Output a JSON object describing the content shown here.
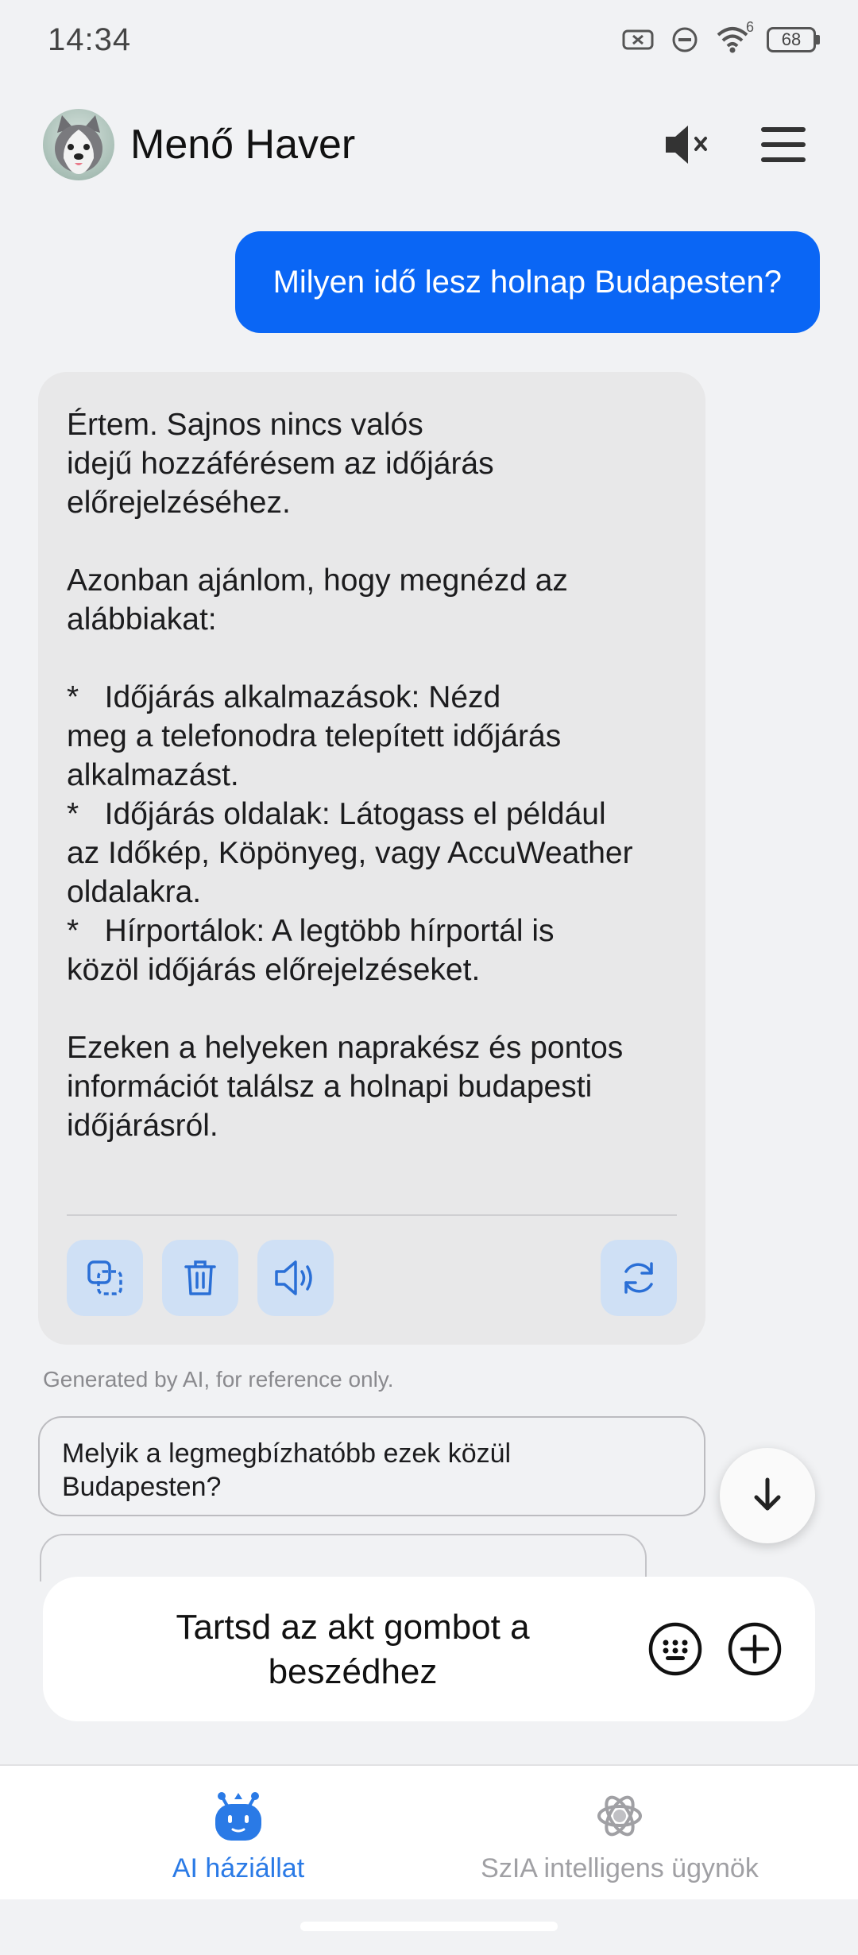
{
  "status_bar": {
    "time": "14:34",
    "battery": "68",
    "wifi_badge": "6",
    "icons": [
      "sim-off-icon",
      "do-not-disturb-icon",
      "wifi-icon",
      "battery-icon"
    ]
  },
  "header": {
    "title": "Menő Haver",
    "avatar": "husky-avatar",
    "icons": [
      "speaker-muted-icon",
      "menu-icon"
    ]
  },
  "conversation": {
    "user_message": "Milyen idő lesz holnap Budapesten?",
    "ai_message": {
      "paragraphs": [
        "Értem. Sajnos nincs valós\nidejű hozzáférésem az időjárás\nelőrejelzéséhez.",
        "Azonban ajánlom, hogy megnézd az\nalábbiakat:",
        "*   Időjárás alkalmazások: Nézd\nmeg a telefonodra telepített időjárás\nalkalmazást.\n*   Időjárás oldalak: Látogass el például\naz Időkép, Köpönyeg, vagy AccuWeather\noldalakra.\n*   Hírportálok: A legtöbb hírportál is\nközöl időjárás előrejelzéseket.",
        "Ezeken a helyeken naprakész és pontos\ninformációt találsz a holnapi budapesti\nidőjárásról."
      ],
      "actions": [
        "copy-icon",
        "delete-icon",
        "read-aloud-icon",
        "regenerate-icon"
      ]
    },
    "disclaimer": "Generated by AI, for reference only.",
    "suggestion": "Melyik a legmegbízhatóbb ezek közül\nBudapesten?"
  },
  "input": {
    "hold_to_talk": "Tartsd az akt gombot a\nbeszédhez",
    "icons": [
      "keyboard-icon",
      "add-icon"
    ]
  },
  "bottom_nav": {
    "items": [
      {
        "label": "AI háziállat",
        "icon": "robot-pet-icon",
        "active": true
      },
      {
        "label": "SzIA intelligens ügynök",
        "icon": "agent-swirl-icon",
        "active": false
      }
    ]
  },
  "colors": {
    "accent": "#0a66f5",
    "nav_active": "#2a7ae6",
    "nav_inactive": "#a0a0a4",
    "action_button_bg": "#cfe0f5"
  }
}
